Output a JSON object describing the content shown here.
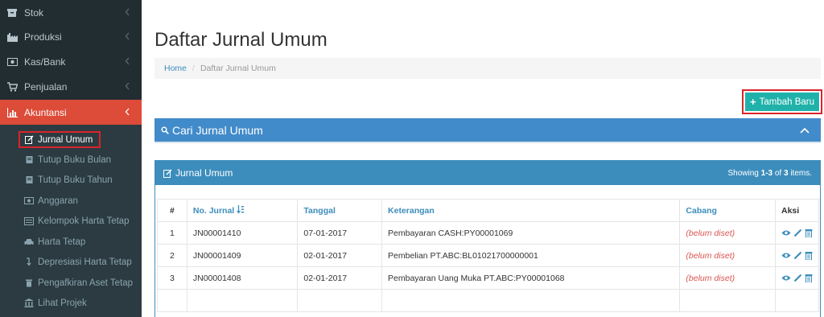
{
  "sidebar": {
    "items": [
      {
        "label": "Stok",
        "icon": "box-icon"
      },
      {
        "label": "Produksi",
        "icon": "factory-icon"
      },
      {
        "label": "Kas/Bank",
        "icon": "money-icon"
      },
      {
        "label": "Penjualan",
        "icon": "cart-icon"
      },
      {
        "label": "Akuntansi",
        "icon": "bar-chart-icon"
      }
    ],
    "subitems": [
      {
        "label": "Jurnal Umum",
        "icon": "edit-icon"
      },
      {
        "label": "Tutup Buku Bulan",
        "icon": "book-icon"
      },
      {
        "label": "Tutup Buku Tahun",
        "icon": "book-icon"
      },
      {
        "label": "Anggaran",
        "icon": "money-icon"
      },
      {
        "label": "Kelompok Harta Tetap",
        "icon": "list-icon"
      },
      {
        "label": "Harta Tetap",
        "icon": "car-icon"
      },
      {
        "label": "Depresiasi Harta Tetap",
        "icon": "level-down-icon"
      },
      {
        "label": "Pengafkiran Aset Tetap",
        "icon": "trash-icon"
      },
      {
        "label": "Lihat Projek",
        "icon": "institution-icon"
      }
    ]
  },
  "page": {
    "title": "Daftar Jurnal Umum",
    "breadcrumb": {
      "home": "Home",
      "separator": "/",
      "current": "Daftar Jurnal Umum"
    },
    "add_button": "Tambah Baru",
    "search_panel_title": "Cari Jurnal Umum"
  },
  "jurnal_panel": {
    "title": "Jurnal Umum",
    "showing_prefix": "Showing ",
    "showing_range": "1-3",
    "showing_of": " of ",
    "showing_total": "3",
    "showing_suffix": " items."
  },
  "table": {
    "headers": {
      "num": "#",
      "no_jurnal": "No. Jurnal",
      "tanggal": "Tanggal",
      "keterangan": "Keterangan",
      "cabang": "Cabang",
      "aksi": "Aksi"
    },
    "rows": [
      {
        "num": "1",
        "no_jurnal": "JN00001410",
        "tanggal": "07-01-2017",
        "keterangan": "Pembayaran CASH:PY00001069",
        "cabang": "(belum diset)"
      },
      {
        "num": "2",
        "no_jurnal": "JN00001409",
        "tanggal": "02-01-2017",
        "keterangan": "Pembelian PT.ABC:BL01021700000001",
        "cabang": "(belum diset)"
      },
      {
        "num": "3",
        "no_jurnal": "JN00001408",
        "tanggal": "02-01-2017",
        "keterangan": "Pembayaran Uang Muka PT.ABC:PY00001068",
        "cabang": "(belum diset)"
      }
    ]
  },
  "colors": {
    "sidebar_bg": "#222d32",
    "active_red": "#dd4b39",
    "primary_blue": "#3c8dbc",
    "teal_button": "#20b2aa",
    "highlight_box": "#d9242a"
  }
}
